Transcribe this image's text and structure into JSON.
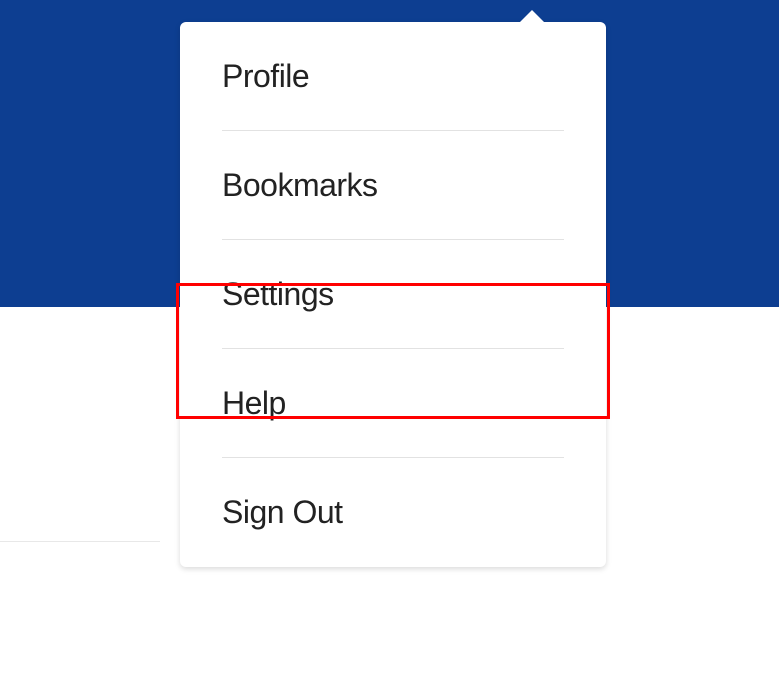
{
  "dropdown": {
    "items": [
      {
        "label": "Profile"
      },
      {
        "label": "Bookmarks"
      },
      {
        "label": "Settings"
      },
      {
        "label": "Help"
      },
      {
        "label": "Sign Out"
      }
    ],
    "highlighted_index": 2
  },
  "colors": {
    "topbar": "#0d3e91",
    "highlight": "#ff0000"
  }
}
